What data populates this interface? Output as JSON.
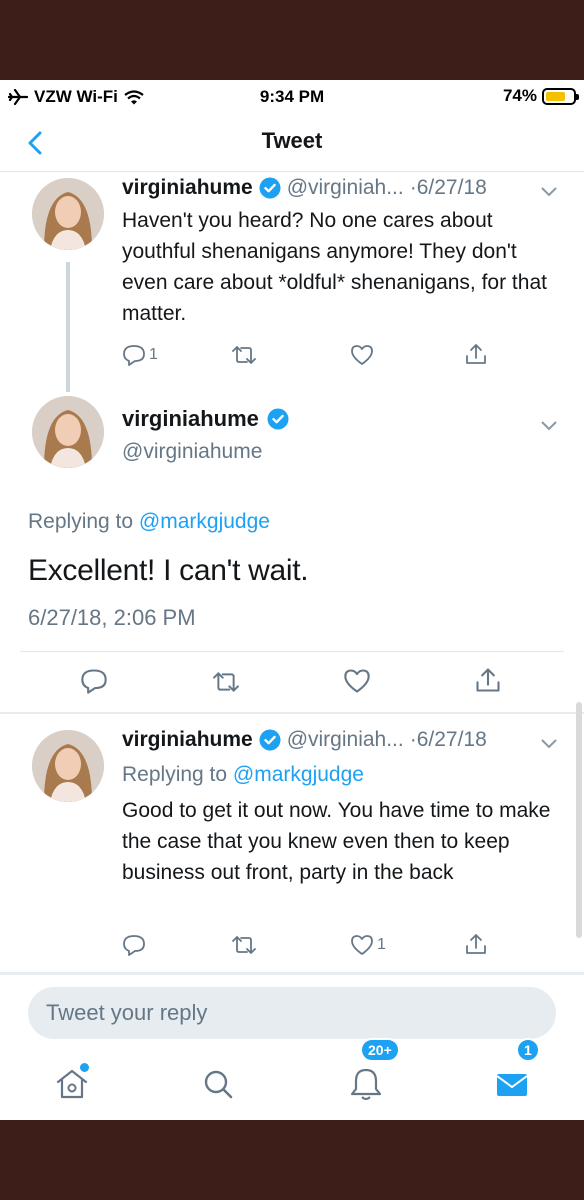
{
  "status_bar": {
    "carrier": "VZW Wi-Fi",
    "time": "9:34 PM",
    "battery": "74%"
  },
  "nav": {
    "title": "Tweet"
  },
  "tweets": [
    {
      "name": "virginiahume",
      "handle": "@virginiah...",
      "date": "·6/27/18",
      "text": "Haven't you heard?  No one cares about youthful shenanigans anymore! They don't even care about *oldful* shenanigans, for that matter.",
      "reply_count": "1",
      "like_count": ""
    },
    {
      "name": "virginiahume",
      "handle": "@virginiah...",
      "date": "·6/27/18",
      "replying_to_label": "Replying to",
      "replying_to_user": "@markgjudge",
      "text": "Good to get it out now. You have time to make the case that you knew even then to keep business out front, party in the back",
      "reply_count": "",
      "like_count": "1"
    }
  ],
  "main_tweet": {
    "name": "virginiahume",
    "handle": "@virginiahume",
    "replying_to_label": "Replying to",
    "replying_to_user": "@markgjudge",
    "text": "Excellent! I can't wait.",
    "timestamp": "6/27/18, 2:06 PM"
  },
  "composer": {
    "placeholder": "Tweet your reply"
  },
  "tab_bar": {
    "notifications_badge": "20+",
    "messages_badge": "1"
  },
  "colors": {
    "accent": "#1da1f2",
    "muted": "#657786",
    "outer_background": "#3e1e18"
  }
}
